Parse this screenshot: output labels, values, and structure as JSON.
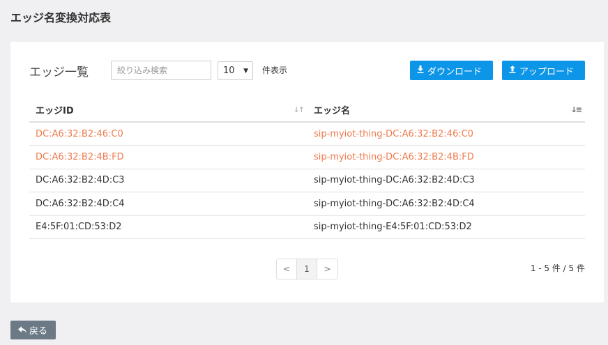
{
  "page": {
    "title": "エッジ名変換対応表"
  },
  "toolbar": {
    "list_title": "エッジ一覧",
    "search_placeholder": "絞り込み検索",
    "page_size": "10",
    "page_size_label": "件表示",
    "download_label": "ダウンロード",
    "upload_label": "アップロード"
  },
  "icons": {
    "download": "download-icon",
    "upload": "upload-icon",
    "sort": "sort-icon",
    "back": "reply-arrow-icon"
  },
  "colors": {
    "accent": "#0d96e8",
    "highlight": "#f07a4d",
    "back_button": "#6c7a86"
  },
  "table": {
    "headers": [
      "エッジID",
      "エッジ名"
    ],
    "rows": [
      {
        "id": "DC:A6:32:B2:46:C0",
        "name": "sip-myiot-thing-DC:A6:32:B2:46:C0",
        "highlight": true
      },
      {
        "id": "DC:A6:32:B2:4B:FD",
        "name": "sip-myiot-thing-DC:A6:32:B2:4B:FD",
        "highlight": true
      },
      {
        "id": "DC:A6:32:B2:4D:C3",
        "name": "sip-myiot-thing-DC:A6:32:B2:4D:C3",
        "highlight": false
      },
      {
        "id": "DC:A6:32:B2:4D:C4",
        "name": "sip-myiot-thing-DC:A6:32:B2:4D:C4",
        "highlight": false
      },
      {
        "id": "E4:5F:01:CD:53:D2",
        "name": "sip-myiot-thing-E4:5F:01:CD:53:D2",
        "highlight": false
      }
    ]
  },
  "pagination": {
    "prev": "<",
    "current": "1",
    "next": ">",
    "count_label": "1 - 5 件 / 5 件"
  },
  "footer": {
    "back_label": "戻る"
  }
}
